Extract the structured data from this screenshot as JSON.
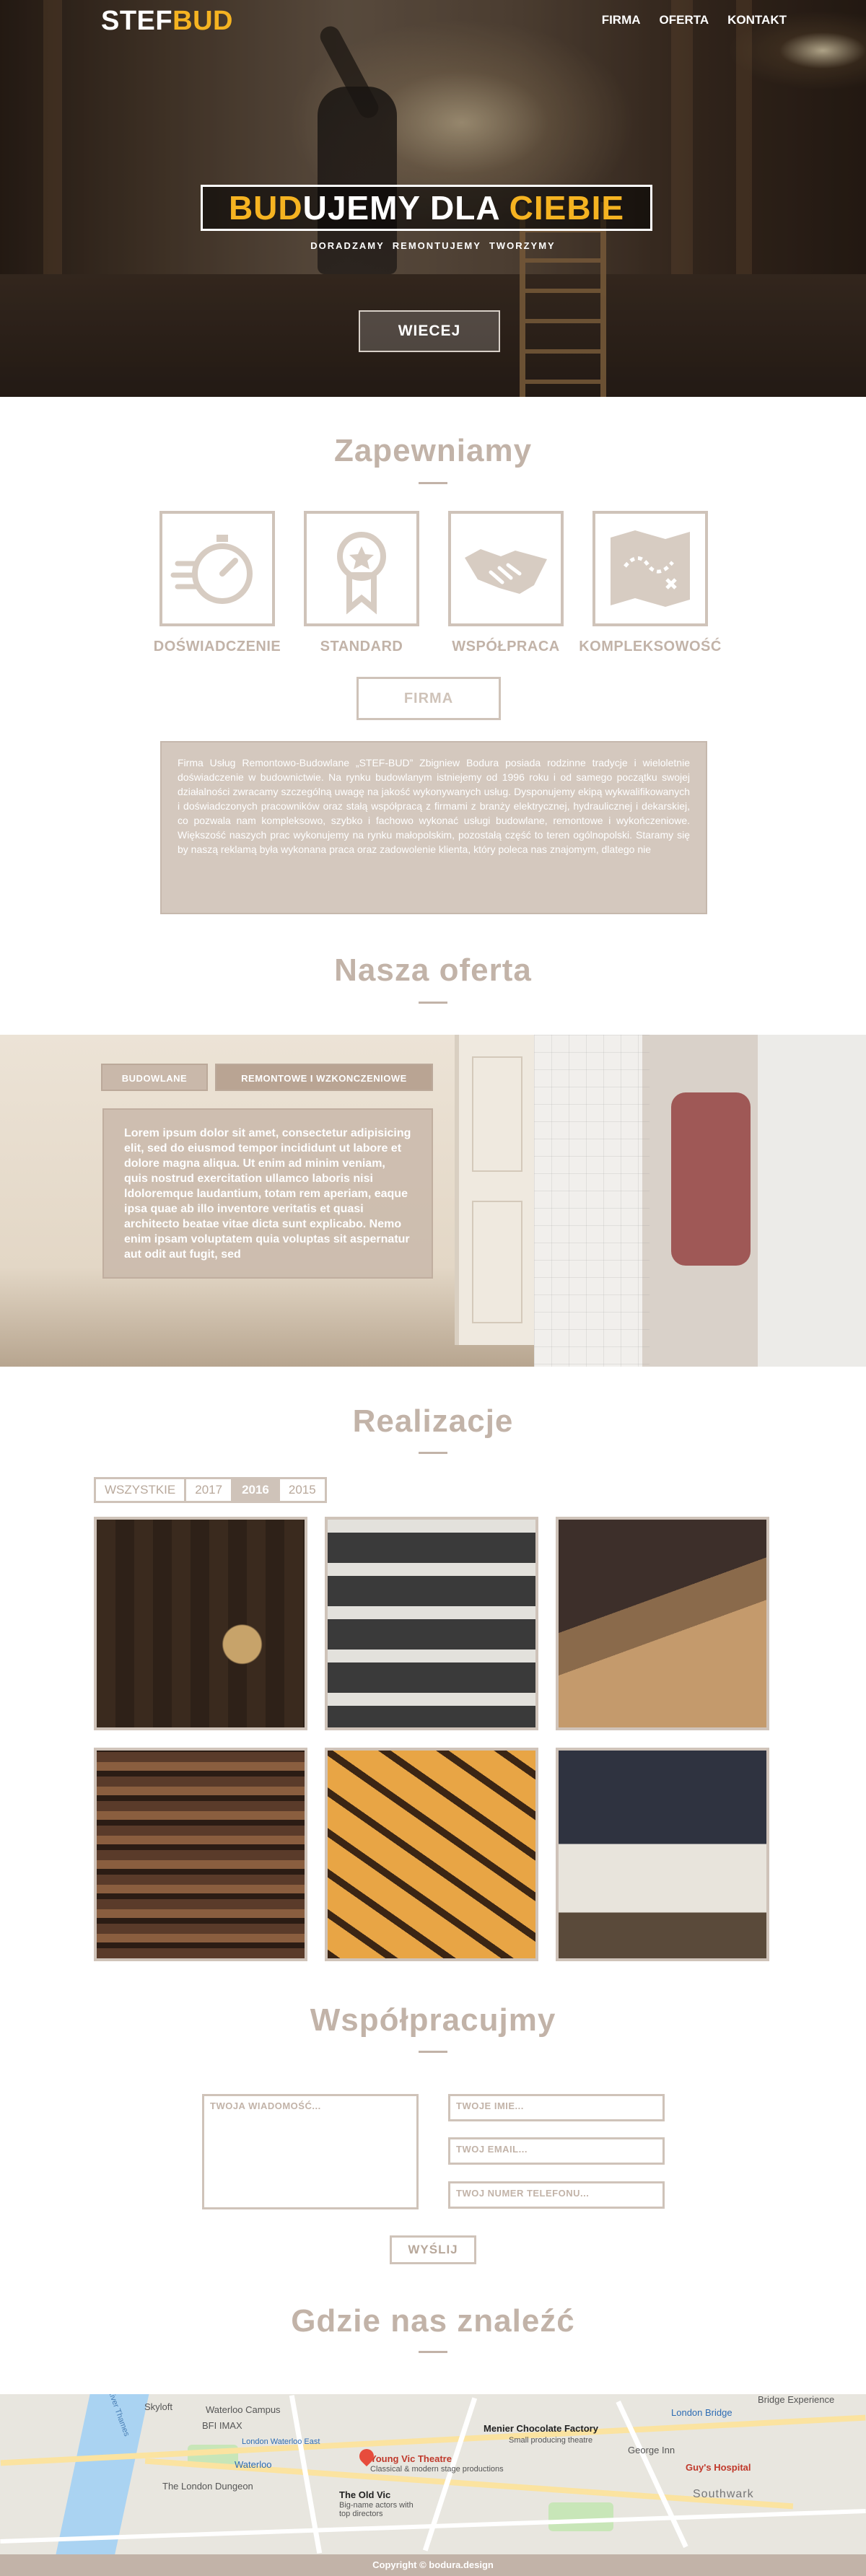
{
  "brand": {
    "part1": "STEF",
    "part2": "BUD"
  },
  "nav": {
    "items": [
      "FIRMA",
      "OFERTA",
      "KONTAKT"
    ]
  },
  "hero": {
    "title_part1": "BUD",
    "title_part2": "UJEMY",
    "title_part3": "DLA",
    "title_part4": "CIEBIE",
    "subtitle": "DORADZAMY  REMONTUJEMY  TWORZYMY",
    "button": "WIECEJ"
  },
  "features": {
    "heading": "Zapewniamy",
    "items": [
      {
        "label": "DOŚWIADCZENIE",
        "icon": "stopwatch-icon"
      },
      {
        "label": "STANDARD",
        "icon": "award-medal-icon"
      },
      {
        "label": "WSPÓŁPRACA",
        "icon": "handshake-icon"
      },
      {
        "label": "KOMPLEKSOWOŚĆ",
        "icon": "map-icon"
      }
    ],
    "button": "FIRMA",
    "about_text": "Firma Usług Remontowo-Budowlane „STEF-BUD” Zbigniew Bodura posiada rodzinne tradycje i wieloletnie doświadczenie w budownictwie. Na rynku budowlanym istniejemy od 1996 roku i od samego początku swojej działalności zwracamy szczególną uwagę na jakość wykonywanych usług. Dysponujemy ekipą wykwalifikowanych i doświadczonych pracowników oraz stałą współpracą z firmami z branży elektrycznej, hydraulicznej i dekarskiej, co pozwala nam kompleksowo, szybko i fachowo wykonać usługi budowlane, remontowe i wykończeniowe. Większość naszych prac wykonujemy na rynku małopolskim, pozostałą część to teren ogólnopolski. Staramy się by naszą reklamą była wykonana praca oraz zadowolenie klienta, który poleca nas znajomym, dlatego nie"
  },
  "offer": {
    "heading": "Nasza oferta",
    "tabs": [
      "BUDOWLANE",
      "REMONTOWE I WZKONCZENIOWE"
    ],
    "text": "Lorem ipsum dolor sit amet, consectetur adipisicing elit, sed do eiusmod tempor incididunt ut labore et dolore magna aliqua. Ut enim ad minim veniam, quis nostrud exercitation ullamco laboris nisi ldoloremque laudantium, totam rem aperiam, eaque ipsa quae ab illo inventore veritatis et quasi architecto beatae vitae dicta sunt explicabo. Nemo enim ipsam voluptatem quia voluptas sit aspernatur aut odit aut fugit, sed"
  },
  "projects": {
    "heading": "Realizacje",
    "filters": [
      "WSZYSTKIE",
      "2017",
      "2016",
      "2015"
    ],
    "active_filter": "2016"
  },
  "contact": {
    "heading": "Współpracujmy",
    "message_placeholder": "TWOJA WIADOMOŚĆ...",
    "name_placeholder": "TWOJE IMIE...",
    "email_placeholder": "TWOJ EMAIL...",
    "phone_placeholder": "TWOJ NUMER TELEFONU...",
    "send": "WYŚLIJ"
  },
  "location": {
    "heading": "Gdzie nas znaleźć",
    "map_labels": {
      "skyloft": "Skyloft",
      "waterloo_campus": "Waterloo Campus",
      "bfi_imax": "BFI IMAX",
      "london_waterloo_east": "London Waterloo East",
      "waterloo": "Waterloo",
      "london_dungeon": "The London Dungeon",
      "young_vic": "Young Vic Theatre",
      "young_vic_sub": "Classical & modern stage productions",
      "old_vic": "The Old Vic",
      "old_vic_sub": "Big-name actors with top directors",
      "menier": "Menier Chocolate Factory",
      "menier_sub": "Small producing theatre",
      "george_inn": "George Inn",
      "london_bridge": "London Bridge",
      "guys_hospital": "Guy's Hospital",
      "southwark": "Southwark",
      "bridge_experience": "Bridge Experience",
      "river_thames": "River Thames"
    }
  },
  "footer": {
    "text": "Copyright © bodura.design"
  }
}
